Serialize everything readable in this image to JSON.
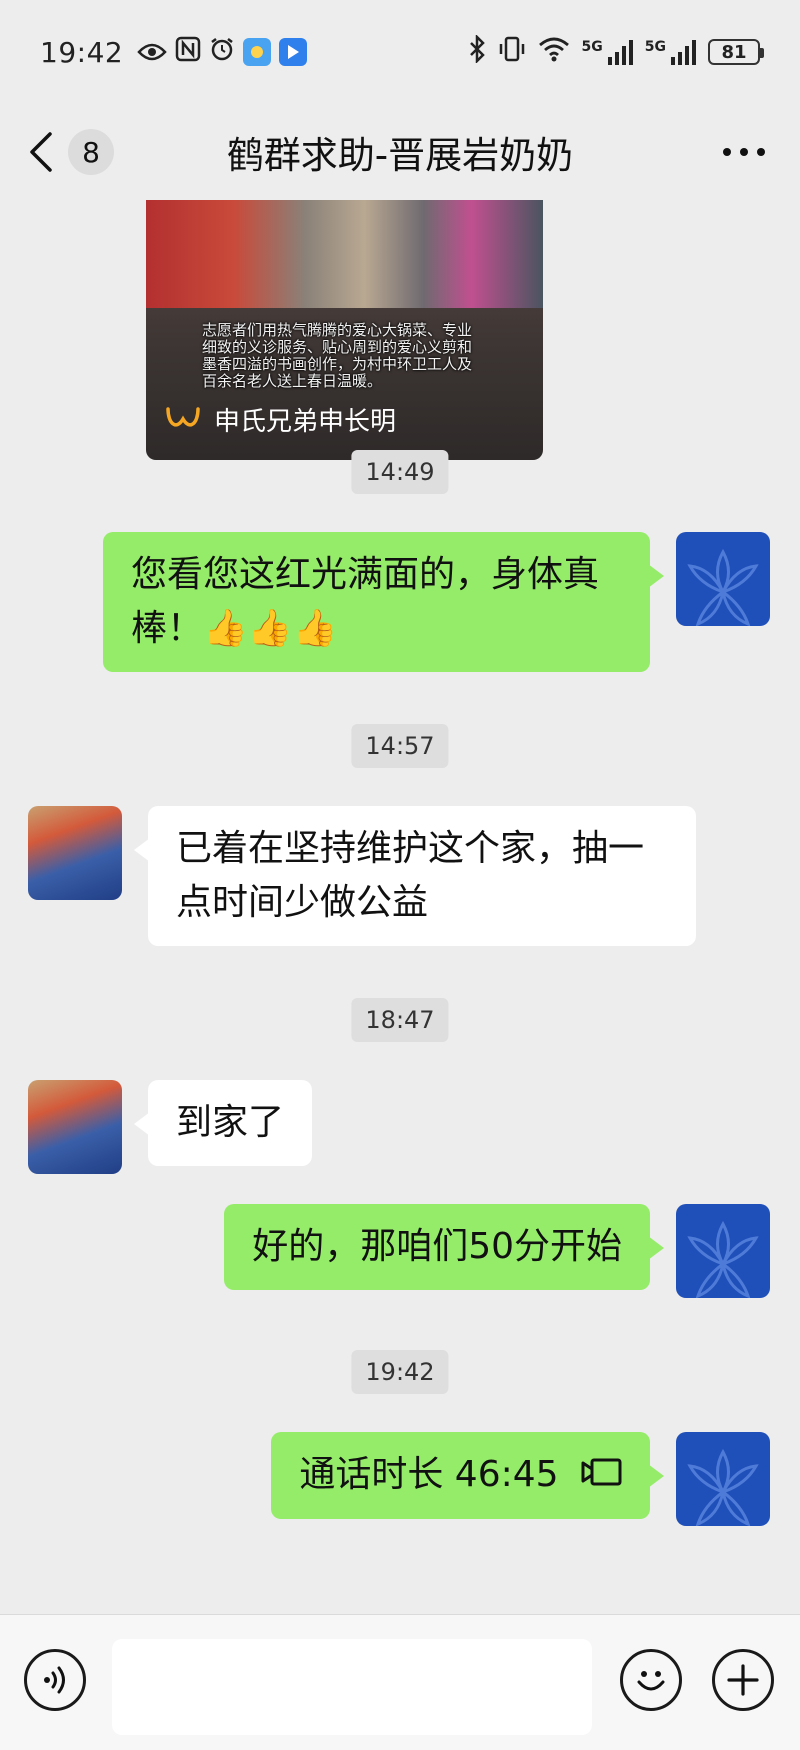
{
  "status_bar": {
    "time": "19:42",
    "battery": "81",
    "network_1": "5G",
    "network_2": "5G",
    "icons_left": [
      "eye-icon",
      "nfc-icon",
      "alarm-icon",
      "weather-icon",
      "app-icon"
    ],
    "icons_right": [
      "bluetooth-icon",
      "vibrate-icon",
      "wifi-icon",
      "signal-icon",
      "signal-icon",
      "battery-icon"
    ]
  },
  "header": {
    "unread_count": "8",
    "title": "鹤群求助-晋展岩奶奶"
  },
  "media_card": {
    "caption": "志愿者们用热气腾腾的爱心大锅菜、专业细致的义诊服务、贴心周到的爱心义剪和墨香四溢的书画创作，为村中环卫工人及百余名老人送上春日温暖。",
    "source": "申氏兄弟申长明"
  },
  "messages": [
    {
      "type": "time",
      "text": "14:49"
    },
    {
      "type": "sent",
      "text": "您看您这红光满面的，身体真棒！👍👍👍"
    },
    {
      "type": "time",
      "text": "14:57"
    },
    {
      "type": "received",
      "text": "已着在坚持维护这个家，抽一点时间少做公益"
    },
    {
      "type": "time",
      "text": "18:47"
    },
    {
      "type": "received",
      "text": "到家了"
    },
    {
      "type": "sent",
      "text": "好的，那咱们50分开始"
    },
    {
      "type": "time",
      "text": "19:42"
    },
    {
      "type": "sent",
      "text": "通话时长 46:45"
    }
  ],
  "input": {
    "placeholder": ""
  },
  "colors": {
    "background": "#ededed",
    "sent_bubble": "#95ec69",
    "received_bubble": "#ffffff",
    "self_avatar": "#1f4fb8"
  }
}
